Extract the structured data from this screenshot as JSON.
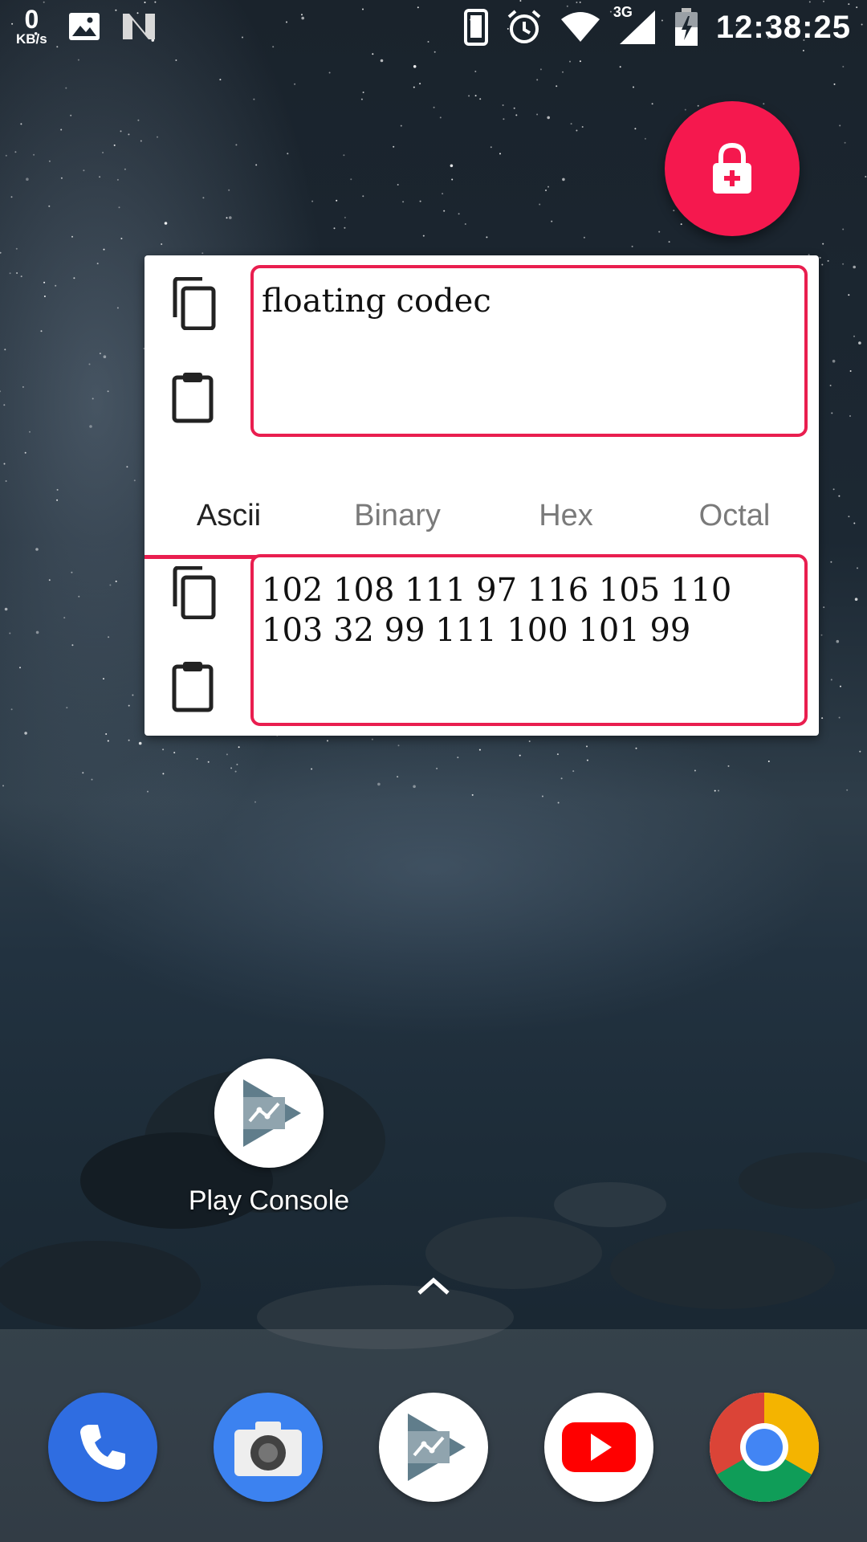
{
  "status_bar": {
    "net_speed_value": "0",
    "net_speed_unit": "KB/s",
    "network_type": "3G",
    "time": "12:38:25"
  },
  "codec": {
    "input_text": "floating codec",
    "output_text": "102 108 111 97 116 105 110 103 32 99 111 100 101 99",
    "tabs": [
      {
        "label": "Ascii",
        "active": true
      },
      {
        "label": "Binary",
        "active": false
      },
      {
        "label": "Hex",
        "active": false
      },
      {
        "label": "Octal",
        "active": false
      }
    ]
  },
  "home": {
    "apps": [
      {
        "label": "Play Console",
        "icon": "play-console-icon"
      }
    ]
  },
  "dock": {
    "apps": [
      "phone-icon",
      "camera-icon",
      "play-console-icon",
      "youtube-icon",
      "chrome-icon"
    ]
  },
  "colors": {
    "accent": "#e91e4f",
    "fab": "#f5184e"
  }
}
